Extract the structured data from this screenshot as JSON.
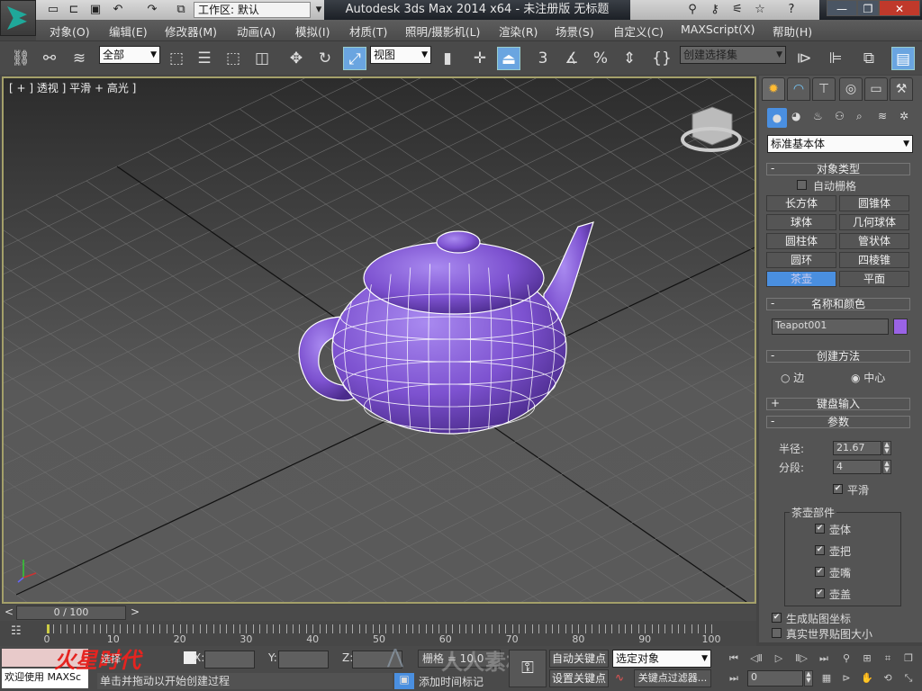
{
  "app": {
    "title": "Autodesk 3ds Max  2014 x64   - 未注册版    无标题",
    "workspace": "工作区: 默认"
  },
  "quick_access": [
    "new-file-icon",
    "open-file-icon",
    "save-icon",
    "undo-icon",
    "redo-icon",
    "project-folder-icon"
  ],
  "menu": [
    "对象(O)",
    "编辑(E)",
    "修改器(M)",
    "动画(A)",
    "模拟(I)",
    "材质(T)",
    "照明/摄影机(L)",
    "渲染(R)",
    "场景(S)",
    "自定义(C)",
    "MAXScript(X)",
    "帮助(H)"
  ],
  "toolbar": {
    "filter": "全部",
    "ref_coord": "视图",
    "selection_set": "创建选择集",
    "snap_angle": "3"
  },
  "viewport": {
    "label": "[ + ] 透视 ] 平滑 + 高光 ]",
    "object_color": "#8b5fd6",
    "accent": "#a4a06a"
  },
  "panel": {
    "category": "标准基本体",
    "object_type": {
      "title": "对象类型",
      "autogrid": "自动栅格",
      "buttons": [
        "长方体",
        "圆锥体",
        "球体",
        "几何球体",
        "圆柱体",
        "管状体",
        "圆环",
        "四棱锥",
        "茶壶",
        "平面"
      ],
      "active": "茶壶"
    },
    "name_color": {
      "title": "名称和颜色",
      "name": "Teapot001",
      "color": "#9a63e6"
    },
    "creation_method": {
      "title": "创建方法",
      "options": [
        "边",
        "中心"
      ],
      "selected": "中心"
    },
    "keyboard_entry": {
      "title": "键盘输入"
    },
    "parameters": {
      "title": "参数",
      "radius_label": "半径:",
      "radius": "21.67",
      "segments_label": "分段:",
      "segments": "4",
      "smooth": "平滑",
      "parts_title": "茶壶部件",
      "parts": [
        "壶体",
        "壶把",
        "壶嘴",
        "壶盖"
      ]
    },
    "gen_mapping": "生成贴图坐标",
    "real_world": "真实世界贴图大小"
  },
  "timeline": {
    "frame": "0 / 100",
    "ticks": [
      "0",
      "10",
      "20",
      "30",
      "40",
      "50",
      "60",
      "70",
      "80",
      "90",
      "100"
    ]
  },
  "status": {
    "welcome": "欢迎使用 MAXSc",
    "selection": "选择",
    "x_label": "X:",
    "y_label": "Y:",
    "z_label": "Z:",
    "grid": "栅格 = 10.0",
    "prompt": "单击并拖动以开始创建过程",
    "add_time_tag": "添加时间标记",
    "auto_key": "自动关键点",
    "set_key": "设置关键点",
    "key_mode": "选定对象",
    "key_filters": "关键点过滤器...",
    "current_frame": "0"
  },
  "watermark": {
    "logo": "火星时代",
    "site": "w w w . h x s d . c o m",
    "overlay": "人人素材"
  }
}
